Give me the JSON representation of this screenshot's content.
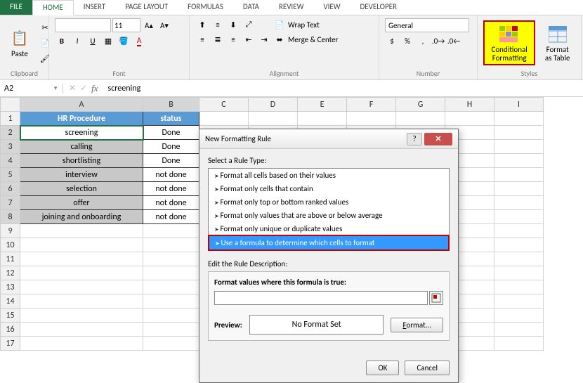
{
  "tabs": {
    "file": "FILE",
    "home": "HOME",
    "insert": "INSERT",
    "pageLayout": "PAGE LAYOUT",
    "formulas": "FORMULAS",
    "data": "DATA",
    "review": "REVIEW",
    "view": "VIEW",
    "developer": "DEVELOPER"
  },
  "ribbon": {
    "clipboard": {
      "paste": "Paste",
      "label": "Clipboard"
    },
    "font": {
      "label": "Font",
      "size": "11"
    },
    "alignment": {
      "wrap": "Wrap Text",
      "merge": "Merge & Center",
      "label": "Alignment"
    },
    "number": {
      "format": "General",
      "label": "Number"
    },
    "styles": {
      "cond": "Conditional Formatting",
      "table": "Format as Table",
      "label": "Styles"
    }
  },
  "nameBox": "A2",
  "formulaBar": "screening",
  "columns": [
    "A",
    "B",
    "C",
    "D",
    "E",
    "F",
    "G",
    "H",
    "I"
  ],
  "sheet": {
    "headers": {
      "a": "HR Procedure",
      "b": "status"
    },
    "rows": [
      {
        "a": "screening",
        "b": "Done"
      },
      {
        "a": "calling",
        "b": "Done"
      },
      {
        "a": "shortlisting",
        "b": "Done"
      },
      {
        "a": "interview",
        "b": "not done"
      },
      {
        "a": "selection",
        "b": "not done"
      },
      {
        "a": "offer",
        "b": "not done"
      },
      {
        "a": "joining and onboarding",
        "b": "not done"
      }
    ]
  },
  "dialog": {
    "title": "New Formatting Rule",
    "selectLabel": "Select a Rule Type:",
    "ruleTypes": [
      "Format all cells based on their values",
      "Format only cells that contain",
      "Format only top or bottom ranked values",
      "Format only values that are above or below average",
      "Format only unique or duplicate values",
      "Use a formula to determine which cells to format"
    ],
    "editLabel": "Edit the Rule Description:",
    "formulaLabel": "Format values where this formula is true:",
    "previewLabel": "Preview:",
    "previewText": "No Format Set",
    "formatBtn": "Format...",
    "ok": "OK",
    "cancel": "Cancel"
  }
}
